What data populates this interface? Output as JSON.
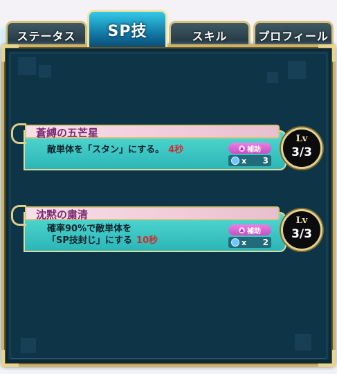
{
  "tabs": [
    {
      "label": "ステータス",
      "active": false
    },
    {
      "label": "SP技",
      "active": true
    },
    {
      "label": "スキル",
      "active": false
    },
    {
      "label": "プロフィール",
      "active": false
    }
  ],
  "skills": [
    {
      "name": "蒼縛の五芒星",
      "description_line1": "敵単体を「スタン」にする。",
      "description_line2": "",
      "duration": "4秒",
      "tag": "補助",
      "uses_prefix": "x",
      "uses": "3",
      "lv_label": "Lv",
      "level": "3/3"
    },
    {
      "name": "沈黙の粛清",
      "description_line1": "確率90%で敵単体を",
      "description_line2": "「SP技封じ」にする",
      "duration": "10秒",
      "tag": "補助",
      "uses_prefix": "x",
      "uses": "2",
      "lv_label": "Lv",
      "level": "3/3"
    }
  ],
  "colors": {
    "panel_bg": "#0e3447",
    "gold_frame": "#cdb36a",
    "card_teal": "#52d9d2",
    "title_pink": "#f0c9d8",
    "name_text": "#7c2a74",
    "duration_red": "#d22b2b",
    "tag_magenta": "#c64fc2"
  },
  "icons": {
    "tag": "support-icon",
    "uses": "clock-icon"
  }
}
